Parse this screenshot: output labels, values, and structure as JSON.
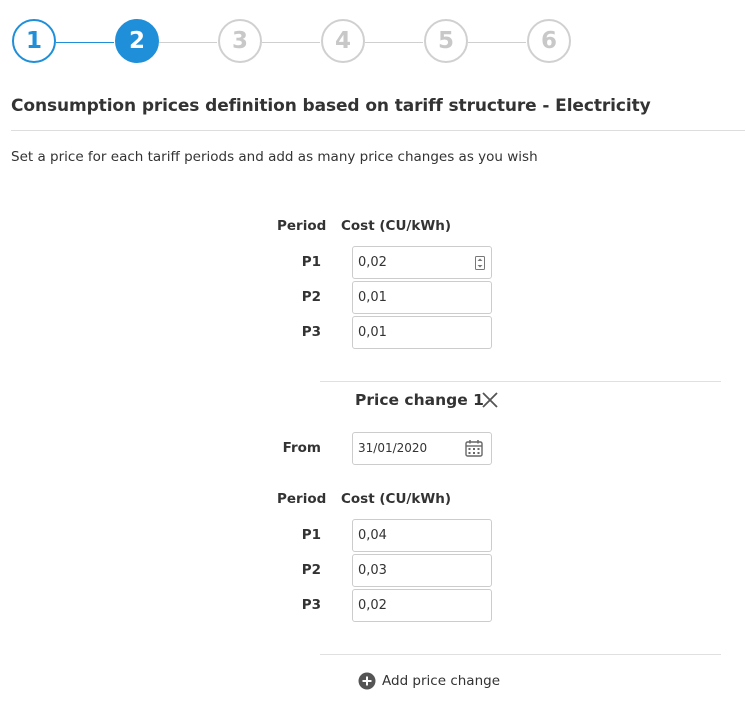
{
  "stepper": {
    "steps": [
      {
        "label": "1",
        "state": "done"
      },
      {
        "label": "2",
        "state": "current"
      },
      {
        "label": "3",
        "state": "todo"
      },
      {
        "label": "4",
        "state": "todo"
      },
      {
        "label": "5",
        "state": "todo"
      },
      {
        "label": "6",
        "state": "todo"
      }
    ],
    "accent_color": "#1e8fd8",
    "inactive_color": "#d0d0d0"
  },
  "page": {
    "title": "Consumption prices definition based on tariff structure - Electricity",
    "subtitle": "Set a price for each tariff periods and add as many price changes as you wish"
  },
  "base_prices": {
    "period_header": "Period",
    "cost_header": "Cost (CU/kWh)",
    "rows": [
      {
        "period": "P1",
        "value": "0,02"
      },
      {
        "period": "P2",
        "value": "0,01"
      },
      {
        "period": "P3",
        "value": "0,01"
      }
    ]
  },
  "price_change": {
    "title": "Price change 1",
    "from_label": "From",
    "from_value": "31/01/2020",
    "period_header": "Period",
    "cost_header": "Cost (CU/kWh)",
    "rows": [
      {
        "period": "P1",
        "value": "0,04"
      },
      {
        "period": "P2",
        "value": "0,03"
      },
      {
        "period": "P3",
        "value": "0,02"
      }
    ]
  },
  "add_price_change_label": "Add price change",
  "icons": {
    "close": "close-icon",
    "calendar": "calendar-icon",
    "add": "plus-circle-icon",
    "spinner": "number-spinner-icon"
  }
}
